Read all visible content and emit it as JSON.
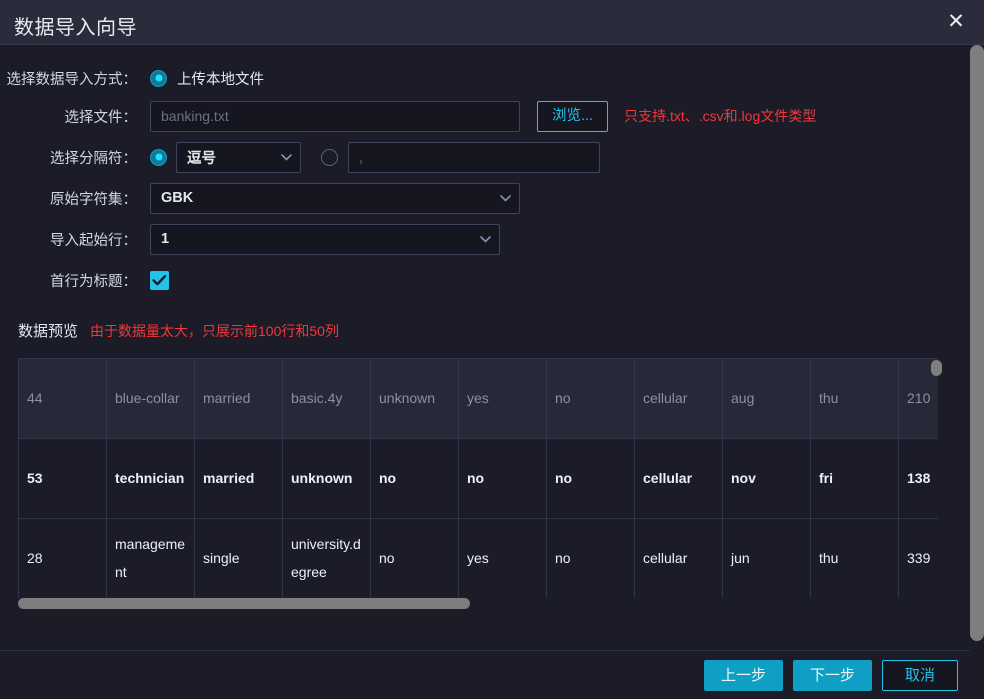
{
  "titlebar": {
    "title": "数据导入向导",
    "close_label": "✕"
  },
  "form": {
    "import_method": {
      "label": "选择数据导入方式：",
      "option_label": "上传本地文件",
      "selected": true
    },
    "file": {
      "label": "选择文件：",
      "placeholder": "banking.txt",
      "value": "",
      "browse_label": "浏览...",
      "hint": "只支持.txt、.csv和.log文件类型"
    },
    "separator": {
      "label": "选择分隔符：",
      "preset_selected": true,
      "preset_value": "逗号",
      "custom_selected": false,
      "custom_placeholder": ",",
      "custom_value": ""
    },
    "charset": {
      "label": "原始字符集：",
      "value": "GBK"
    },
    "start_row": {
      "label": "导入起始行：",
      "value": "1"
    },
    "first_row_header": {
      "label": "首行为标题：",
      "checked": true
    }
  },
  "preview": {
    "title": "数据预览",
    "note": "由于数据量太大，只展示前100行和50列",
    "rows": [
      {
        "style": "hdr",
        "cells": [
          "44",
          "blue-collar",
          "married",
          "basic.4y",
          "unknown",
          "yes",
          "no",
          "cellular",
          "aug",
          "thu",
          "210"
        ]
      },
      {
        "style": "r1",
        "cells": [
          "53",
          "technician",
          "married",
          "unknown",
          "no",
          "no",
          "no",
          "cellular",
          "nov",
          "fri",
          "138"
        ]
      },
      {
        "style": "r2",
        "cells": [
          "28",
          "management",
          "single",
          "university.degree",
          "no",
          "yes",
          "no",
          "cellular",
          "jun",
          "thu",
          "339"
        ]
      }
    ]
  },
  "footer": {
    "prev_label": "上一步",
    "next_label": "下一步",
    "cancel_label": "取消"
  },
  "colors": {
    "accent": "#23c2e8",
    "primary_button": "#0f9fc4",
    "danger": "#f0383c",
    "titlebar_bg": "#2a2c3b",
    "body_bg": "#1b1c27"
  }
}
